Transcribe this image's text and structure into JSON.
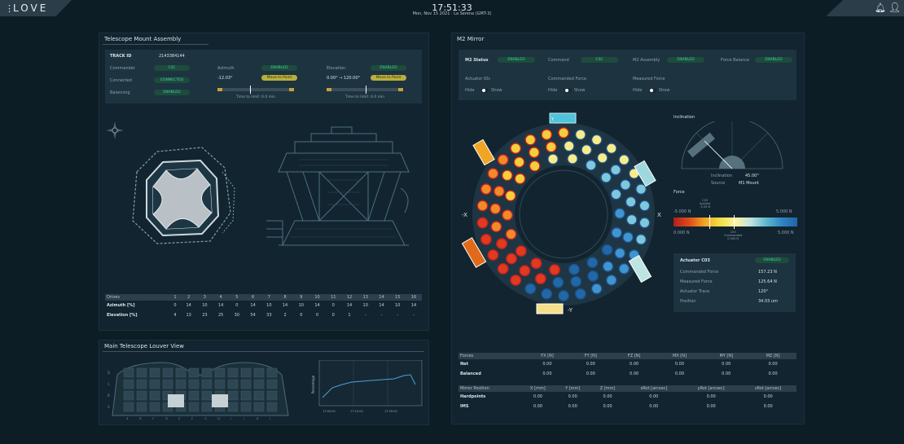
{
  "app": {
    "logo": "LOVE",
    "menu_icon": "vertical-dots-icon",
    "clock": "17:51:33",
    "date": "Mon, Nov 15 2021 · La Serena (GMT-3)",
    "notif_icon": "bell-icon",
    "user_icon": "user-icon"
  },
  "tma": {
    "title": "Telescope Mount Assembly",
    "track_id_label": "TRACK ID",
    "track_id": "2143384144",
    "commander_label": "Commander",
    "commander": "CSC",
    "connected_label": "Connected",
    "connected": "CONNECTED",
    "balancing_label": "Balancing",
    "balancing": "ENABLED",
    "azimuth_label": "Azimuth",
    "azimuth_state": "ENABLED",
    "azimuth_value": "-12.03°",
    "azimuth_mode": "Move to Point",
    "azimuth_status": "Time to limit: 6.0 min",
    "elevation_label": "Elevation",
    "elevation_state": "ENABLED",
    "elevation_value": "0.00° → 120.00°",
    "elevation_mode": "Move to Point",
    "elevation_status": "Time to limit: 6.0 min",
    "drives": {
      "header": [
        "Drives",
        "1",
        "2",
        "3",
        "4",
        "5",
        "6",
        "7",
        "8",
        "9",
        "10",
        "11",
        "12",
        "13",
        "14",
        "15",
        "16"
      ],
      "rows": [
        {
          "label": "Azimuth [%]",
          "values": [
            "0",
            "14",
            "10",
            "14",
            "0",
            "14",
            "10",
            "14",
            "10",
            "14",
            "0",
            "14",
            "10",
            "14",
            "10",
            "14"
          ]
        },
        {
          "label": "Elevation [%]",
          "values": [
            "4",
            "13",
            "23",
            "25",
            "30",
            "54",
            "33",
            "2",
            "0",
            "0",
            "0",
            "1",
            "-",
            "-",
            "-",
            "-"
          ]
        }
      ]
    }
  },
  "louver": {
    "title": "Main Telescope Louver View",
    "row_labels": [
      "D",
      "C",
      "B",
      "A"
    ],
    "col_labels": [
      "A",
      "B",
      "C",
      "D",
      "E",
      "F",
      "G",
      "H",
      "I",
      "J",
      "K",
      "L"
    ],
    "plot_ylabel": "Percentage",
    "plot_x": [
      "17:00:00",
      "17:15:00",
      "17:30:00"
    ]
  },
  "m2": {
    "title": "M2 Mirror",
    "status_label": "M2 Status",
    "status": "ENABLED",
    "command_label": "Command",
    "command": "CSC",
    "assembly_label": "M2 Assembly",
    "assembly": "ENABLED",
    "force_balance_label": "Force Balance",
    "force_balance": "ENABLED",
    "actuator_ids_label": "Actuator IDs",
    "commanded_force_label": "Commanded Force",
    "measured_force_label": "Measured Force",
    "hide": "Hide",
    "show": "Show",
    "axis_y": "Y",
    "axis_x": "X",
    "axis_mx": "-X",
    "axis_my": "-Y",
    "inclination_title": "Inclination",
    "inclination_label": "Inclination",
    "inclination": "45.00°",
    "source_label": "Source",
    "source": "M1 Mount",
    "force_title": "Force",
    "force_min": "-5.000 N",
    "force_max": "5.000 N",
    "force_mid_top": "C03\nApplied\n-5.05 N",
    "force_min2": "0.000 N",
    "force_max2": "5.000 N",
    "force_mid_bot": "C03\nCommanded\n0.000 N",
    "actuator": {
      "title": "Actuator C03",
      "state": "ENABLED",
      "rows": [
        [
          "Commanded Force",
          "157.23 N"
        ],
        [
          "Measured Force",
          "125.64 N"
        ],
        [
          "Actuator Trace",
          "120°"
        ],
        [
          "Position",
          "34.03 um"
        ]
      ]
    },
    "forces_table": {
      "header": [
        "Forces",
        "FX [N]",
        "FY [N]",
        "FZ [N]",
        "MX [N]",
        "MY [N]",
        "MZ [N]"
      ],
      "rows": [
        [
          "Net",
          "0.00",
          "0.00",
          "0.00",
          "0.00",
          "0.00",
          "0.00"
        ],
        [
          "Balanced",
          "0.00",
          "0.00",
          "0.00",
          "0.00",
          "0.00",
          "0.00"
        ]
      ]
    },
    "position_table": {
      "header": [
        "Mirror Position",
        "X [mm]",
        "Y [mm]",
        "Z [mm]",
        "xRot [arcsec]",
        "yRot [arcsec]",
        "zRot [arcsec]"
      ],
      "rows": [
        [
          "Hardpoints",
          "0.00",
          "0.00",
          "0.00",
          "0.00",
          "0.00",
          "0.00"
        ],
        [
          "IMS",
          "0.00",
          "0.00",
          "0.00",
          "0.00",
          "0.00",
          "0.00"
        ]
      ]
    }
  },
  "colors": {
    "ok": "#3fd4a0",
    "accent_yellow": "#b9b03c",
    "panel": "#12242f"
  }
}
